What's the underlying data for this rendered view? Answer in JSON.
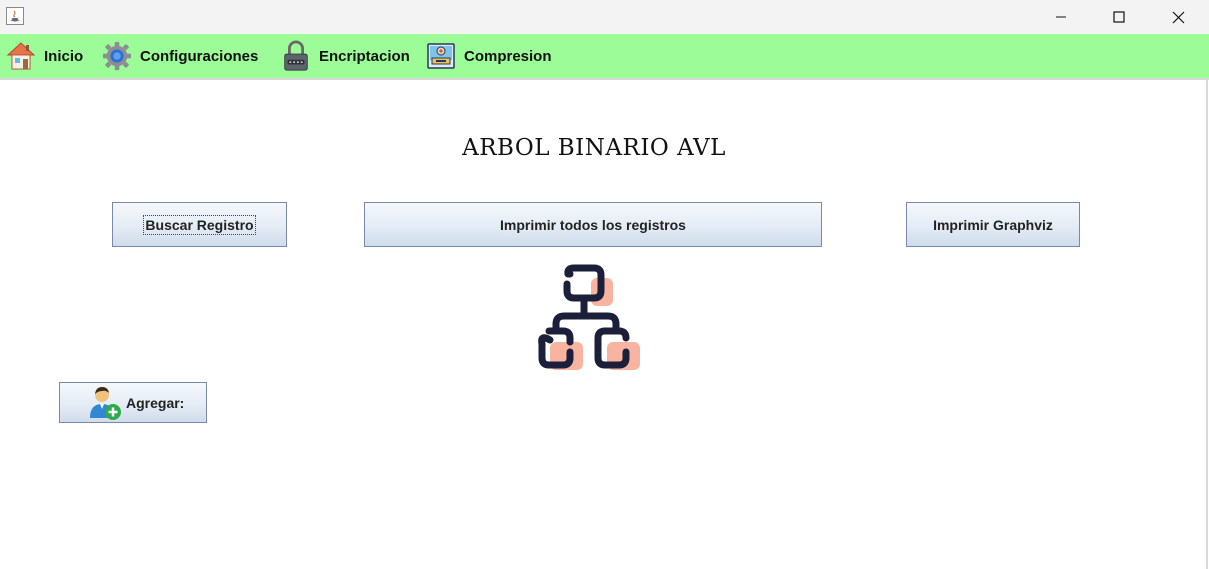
{
  "window": {
    "minimize_icon": "minimize-icon",
    "maximize_icon": "maximize-icon",
    "close_icon": "close-icon"
  },
  "menu": {
    "items": [
      {
        "label": "Inicio",
        "icon": "house-icon"
      },
      {
        "label": "Configuraciones",
        "icon": "gear-icon"
      },
      {
        "label": "Encriptacion",
        "icon": "padlock-icon"
      },
      {
        "label": "Compresion",
        "icon": "archive-icon"
      }
    ]
  },
  "main": {
    "title": "ARBOL BINARIO AVL",
    "buttons": {
      "buscar": "Buscar Registro",
      "imprimir_todos": "Imprimir todos los registros",
      "graphviz": "Imprimir Graphviz",
      "agregar": "Agregar:"
    },
    "icons": {
      "tree": "hierarchy-tree-icon",
      "agregar": "add-user-icon"
    }
  },
  "colors": {
    "menubar": "#9cfd98",
    "tree_stroke": "#1b1f3a",
    "tree_fill": "#f8b4a0"
  }
}
